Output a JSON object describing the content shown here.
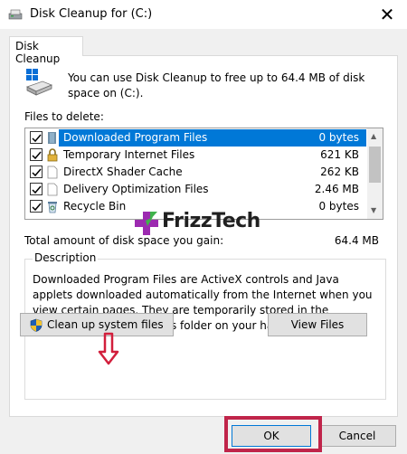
{
  "window": {
    "title": "Disk Cleanup for  (C:)",
    "close_glyph": "✕"
  },
  "tab": {
    "label": "Disk Cleanup"
  },
  "intro_text": "You can use Disk Cleanup to free up to 64.4 MB of disk space on (C:).",
  "files_label": "Files to delete:",
  "files": [
    {
      "name": "Downloaded Program Files",
      "size": "0 bytes",
      "checked": true,
      "selected": true,
      "icon": "folder-icon"
    },
    {
      "name": "Temporary Internet Files",
      "size": "621 KB",
      "checked": true,
      "selected": false,
      "icon": "lock-icon"
    },
    {
      "name": "DirectX Shader Cache",
      "size": "262 KB",
      "checked": true,
      "selected": false,
      "icon": "blank-file-icon"
    },
    {
      "name": "Delivery Optimization Files",
      "size": "2.46 MB",
      "checked": true,
      "selected": false,
      "icon": "blank-file-icon"
    },
    {
      "name": "Recycle Bin",
      "size": "0 bytes",
      "checked": true,
      "selected": false,
      "icon": "recycle-bin-icon"
    }
  ],
  "total": {
    "label": "Total amount of disk space you gain:",
    "value": "64.4 MB"
  },
  "description": {
    "legend": "Description",
    "text": "Downloaded Program Files are ActiveX controls and Java applets downloaded automatically from the Internet when you view certain pages. They are temporarily stored in the Downloaded Program Files folder on your hard disk."
  },
  "buttons": {
    "cleanup_system": "Clean up system files",
    "view_files": "View Files",
    "ok": "OK",
    "cancel": "Cancel"
  },
  "watermark": {
    "text": "FrizzTech"
  },
  "colors": {
    "selection": "#0078d7",
    "highlight_box": "#c0244a",
    "arrow": "#d21f3c",
    "watermark_plus": "#9c2ab0"
  }
}
